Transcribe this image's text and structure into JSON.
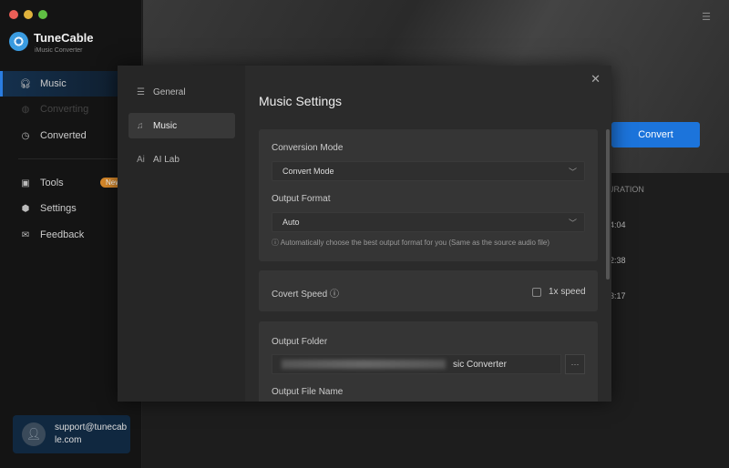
{
  "window": {
    "controls": [
      "#ec5f57",
      "#e0b23c",
      "#5fc043"
    ]
  },
  "brand": {
    "name": "TuneCable",
    "subtitle": "iMusic Converter",
    "accent": "#2a7de1"
  },
  "sidebar": {
    "items": [
      {
        "label": "Music",
        "icon": "headphones-icon",
        "state": "active"
      },
      {
        "label": "Converting",
        "icon": "converting-icon",
        "state": "disabled"
      },
      {
        "label": "Converted",
        "icon": "clock-icon",
        "state": "normal"
      },
      {
        "label": "Tools",
        "icon": "toolbox-icon",
        "state": "normal",
        "badge": "New"
      },
      {
        "label": "Settings",
        "icon": "gear-icon",
        "state": "normal"
      },
      {
        "label": "Feedback",
        "icon": "mail-icon",
        "state": "normal"
      }
    ],
    "user": {
      "email": "support@tunecable.com",
      "icon": "user-icon"
    }
  },
  "main": {
    "convert_label": "Convert",
    "duration_header": "URATION",
    "durations": [
      "4:04",
      "2:38",
      "3:17"
    ],
    "menu_icon": "menu-icon"
  },
  "modal": {
    "nav": [
      {
        "label": "General",
        "icon": "sliders-icon"
      },
      {
        "label": "Music",
        "icon": "music-note-icon",
        "active": true
      },
      {
        "label": "AI Lab",
        "icon": "ai-icon"
      }
    ],
    "title": "Music Settings",
    "conversion_mode": {
      "label": "Conversion Mode",
      "value": "Convert Mode"
    },
    "output_format": {
      "label": "Output Format",
      "value": "Auto",
      "hint": "Automatically choose the best output format for you (Same as the source audio file)"
    },
    "convert_speed": {
      "label": "Covert Speed",
      "checkbox_label": "1x speed",
      "checked": false
    },
    "output_folder": {
      "label": "Output Folder",
      "value_visible": "sic Converter",
      "browse": "···"
    },
    "output_file_name": {
      "label": "Output File Name"
    }
  }
}
